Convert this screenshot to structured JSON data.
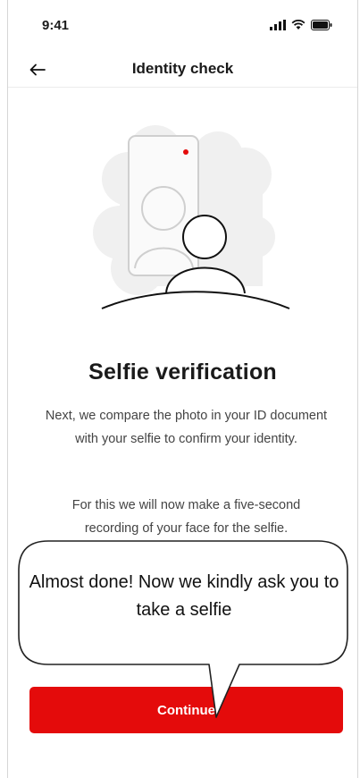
{
  "status_bar": {
    "time": "9:41"
  },
  "nav": {
    "title": "Identity check"
  },
  "content": {
    "heading": "Selfie verification",
    "paragraph1": "Next, we compare the photo in your ID document with your selfie to confirm your identity.",
    "paragraph2": "For this we will now make a five-second recording of your face for the selfie."
  },
  "callout": {
    "text": "Almost done! Now we kindly ask you to take a selfie"
  },
  "button": {
    "continue_label": "Continue"
  },
  "colors": {
    "accent": "#e40b0b"
  },
  "icons": [
    "signal-icon",
    "wifi-icon",
    "battery-icon",
    "back-arrow-icon",
    "selfie-illustration"
  ]
}
